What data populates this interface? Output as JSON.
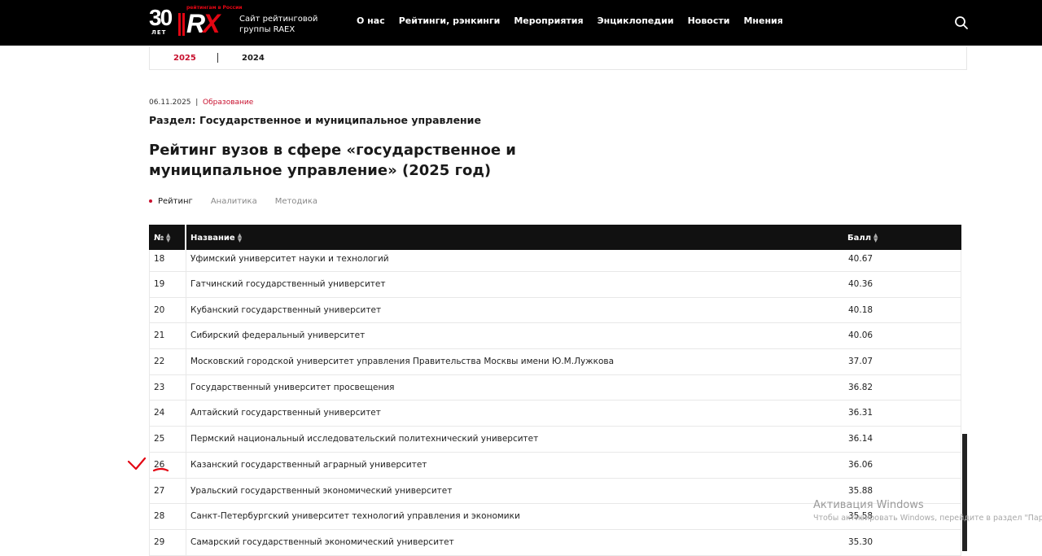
{
  "header": {
    "logo_30": "30",
    "logo_let": "ЛЕТ",
    "logo_rx_r": "R",
    "logo_rx_x": "X",
    "logo_small": "рейтингам в России",
    "tagline": "Сайт рейтинговой группы RAEX",
    "nav": [
      "О нас",
      "Рейтинги, рэнкинги",
      "Мероприятия",
      "Энциклопедии",
      "Новости",
      "Мнения"
    ]
  },
  "years": {
    "active": "2025",
    "other": "2024"
  },
  "article": {
    "date": "06.11.2025",
    "separator": "|",
    "category": "Образование",
    "section": "Раздел: Государственное и муниципальное управление",
    "title": "Рейтинг вузов в сфере «государственное и муниципальное управление» (2025 год)"
  },
  "tabs": {
    "active": "Рейтинг",
    "t2": "Аналитика",
    "t3": "Методика"
  },
  "table": {
    "headers": {
      "num": "№",
      "name": "Название",
      "score": "Балл"
    },
    "rows": [
      {
        "num": "18",
        "name": "Уфимский университет науки и технологий",
        "score": "40.67"
      },
      {
        "num": "19",
        "name": "Гатчинский государственный университет",
        "score": "40.36"
      },
      {
        "num": "20",
        "name": "Кубанский государственный университет",
        "score": "40.18"
      },
      {
        "num": "21",
        "name": "Сибирский федеральный университет",
        "score": "40.06"
      },
      {
        "num": "22",
        "name": "Московский городской университет управления Правительства Москвы имени Ю.М.Лужкова",
        "score": "37.07"
      },
      {
        "num": "23",
        "name": "Государственный университет просвещения",
        "score": "36.82"
      },
      {
        "num": "24",
        "name": "Алтайский государственный университет",
        "score": "36.31"
      },
      {
        "num": "25",
        "name": "Пермский национальный исследовательский политехнический университет",
        "score": "36.14"
      },
      {
        "num": "26",
        "name": "Казанский государственный аграрный университет",
        "score": "36.06"
      },
      {
        "num": "27",
        "name": "Уральский государственный экономический университет",
        "score": "35.88"
      },
      {
        "num": "28",
        "name": "Санкт-Петербургский университет технологий управления и экономики",
        "score": "35.58"
      },
      {
        "num": "29",
        "name": "Самарский государственный экономический университет",
        "score": "35.30"
      }
    ]
  },
  "watermark": {
    "line1": "Активация Windows",
    "line2": "Чтобы активировать Windows, перейдите в раздел \"Пар"
  },
  "colors": {
    "accent": "#c8102e",
    "header_bg": "#000000",
    "annotation": "#e30613"
  }
}
